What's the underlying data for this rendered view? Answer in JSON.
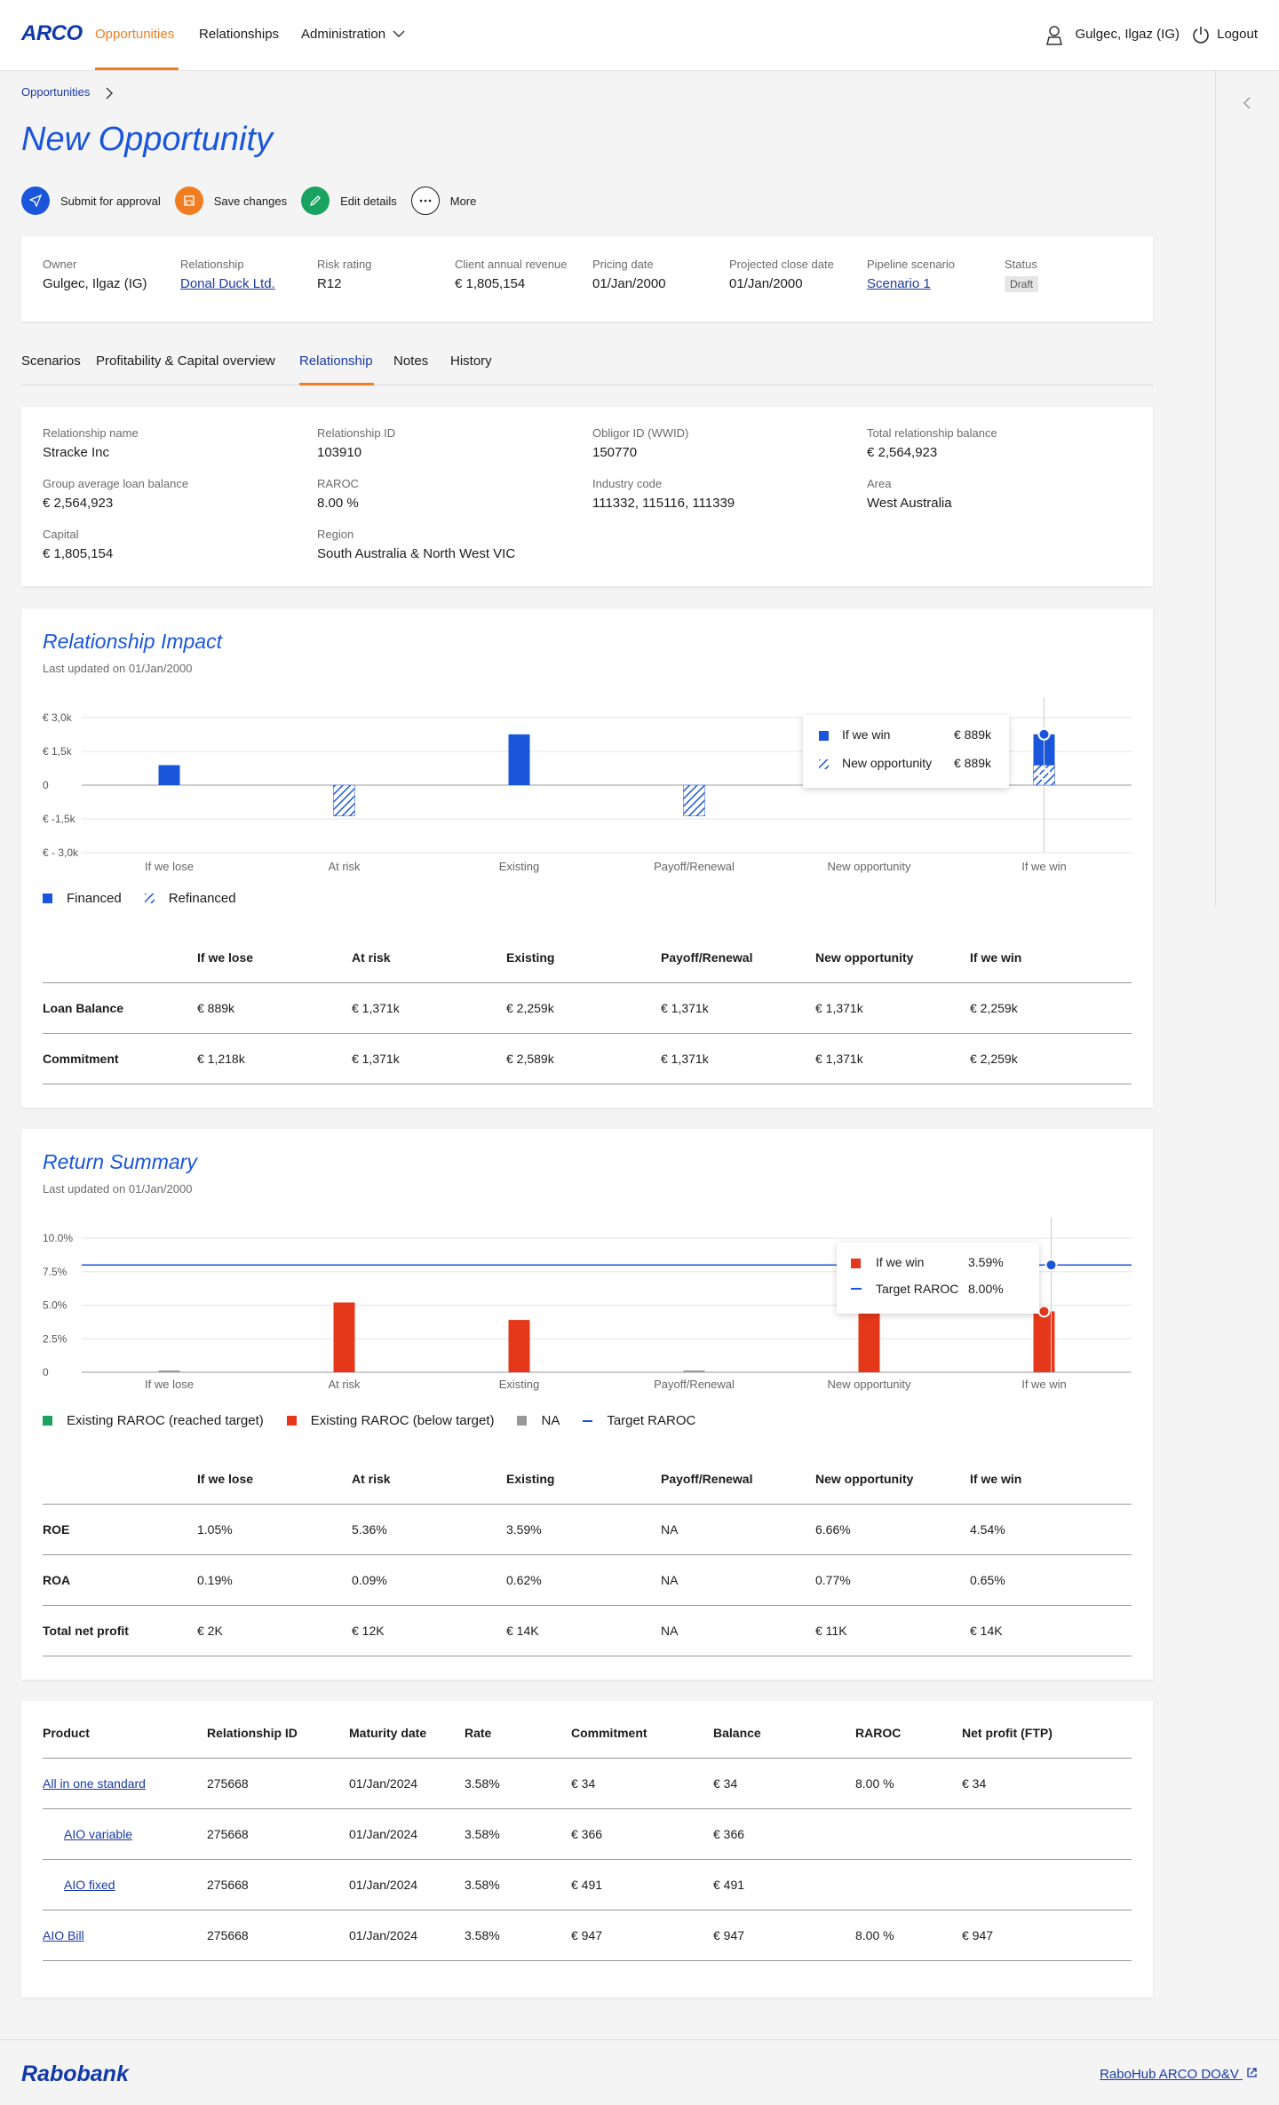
{
  "header": {
    "logo": "ARCO",
    "nav": [
      "Opportunities",
      "Relationships",
      "Administration"
    ],
    "user": "Gulgec, Ilgaz (IG)",
    "logout": "Logout"
  },
  "breadcrumb": "Opportunities",
  "page_title": "New Opportunity",
  "actions": [
    {
      "label": "Submit for approval",
      "icon": "send-icon",
      "color": "#1a56db"
    },
    {
      "label": "Save changes",
      "icon": "save-icon",
      "color": "#ef7d22"
    },
    {
      "label": "Edit details",
      "icon": "pencil-icon",
      "color": "#1aa260"
    },
    {
      "label": "More",
      "icon": "more-icon",
      "color": "#ffffff"
    }
  ],
  "summary": {
    "owner_label": "Owner",
    "owner": "Gulgec, Ilgaz (IG)",
    "relationship_label": "Relationship",
    "relationship": "Donal Duck Ltd.",
    "risk_label": "Risk rating",
    "risk": "R12",
    "revenue_label": "Client annual revenue",
    "revenue": "€ 1,805,154",
    "pricing_label": "Pricing date",
    "pricing": "01/Jan/2000",
    "close_label": "Projected close date",
    "close": "01/Jan/2000",
    "pipeline_label": "Pipeline scenario",
    "pipeline": "Scenario 1",
    "status_label": "Status",
    "status": "Draft"
  },
  "tabs": [
    "Scenarios",
    "Profitability & Capital overview",
    "Relationship",
    "Notes",
    "History"
  ],
  "relationship_info": {
    "name_label": "Relationship name",
    "name": "Stracke Inc",
    "id_label": "Relationship ID",
    "id": "103910",
    "obligor_label": "Obligor ID (WWID)",
    "obligor": "150770",
    "total_label": "Total relationship balance",
    "total": "€ 2,564,923",
    "gavg_label": "Group average loan balance",
    "gavg": "€ 2,564,923",
    "raroc_label": "RAROC",
    "raroc": "8.00 %",
    "industry_label": "Industry code",
    "industry": "111332, 115116, 111339",
    "area_label": "Area",
    "area": "West Australia",
    "capital_label": "Capital",
    "capital": "€ 1,805,154",
    "region_label": "Region",
    "region": "South Australia & North West VIC"
  },
  "impact": {
    "title": "Relationship Impact",
    "updated": "Last updated on 01/Jan/2000",
    "tooltip": {
      "win_label": "If we win",
      "win_value": "€ 889k",
      "new_label": "New opportunity",
      "new_value": "€ 889k"
    },
    "legend": {
      "financed": "Financed",
      "refinanced": "Refinanced"
    },
    "table": {
      "headers": [
        "",
        "If  we lose",
        "At risk",
        "Existing",
        "Payoff/Renewal",
        "New opportunity",
        "If we win"
      ],
      "rows": [
        [
          "Loan Balance",
          "€ 889k",
          "€ 1,371k",
          "€ 2,259k",
          "€ 1,371k",
          "€ 1,371k",
          "€ 2,259k"
        ],
        [
          "Commitment",
          "€ 1,218k",
          "€ 1,371k",
          "€ 2,589k",
          "€ 1,371k",
          "€ 1,371k",
          "€ 2,259k"
        ]
      ]
    }
  },
  "returns": {
    "title": "Return Summary",
    "updated": "Last updated on 01/Jan/2000",
    "tooltip": {
      "win_label": "If we win",
      "win_value": "3.59%",
      "target_label": "Target RAROC",
      "target_value": "8.00%"
    },
    "legend": [
      "Existing RAROC (reached target)",
      "Existing RAROC (below target)",
      "NA",
      "Target RAROC"
    ],
    "table": {
      "headers": [
        "",
        "If  we lose",
        "At risk",
        "Existing",
        "Payoff/Renewal",
        "New opportunity",
        "If we win"
      ],
      "rows": [
        [
          "ROE",
          "1.05%",
          "5.36%",
          "3.59%",
          "NA",
          "6.66%",
          "4.54%"
        ],
        [
          "ROA",
          "0.19%",
          "0.09%",
          "0.62%",
          "NA",
          "0.77%",
          "0.65%"
        ],
        [
          "Total net profit",
          "€ 2K",
          "€ 12K",
          "€ 14K",
          "NA",
          "€ 11K",
          "€ 14K"
        ]
      ]
    }
  },
  "products": {
    "headers": [
      "Product",
      "Relationship ID",
      "Maturity date",
      "Rate",
      "Commitment",
      "Balance",
      "RAROC",
      "Net profit (FTP)"
    ],
    "rows": [
      [
        "All in one standard",
        "275668",
        "01/Jan/2024",
        "3.58%",
        "€ 34",
        "€ 34",
        "8.00 %",
        "€ 34"
      ],
      [
        "AIO variable",
        "275668",
        "01/Jan/2024",
        "3.58%",
        "€ 366",
        "€ 366",
        "",
        ""
      ],
      [
        "AIO fixed",
        "275668",
        "01/Jan/2024",
        "3.58%",
        "€ 491",
        "€ 491",
        "",
        ""
      ],
      [
        "AIO Bill",
        "275668",
        "01/Jan/2024",
        "3.58%",
        "€ 947",
        "€ 947",
        "8.00 %",
        "€ 947"
      ]
    ]
  },
  "footer": {
    "logo": "Rabobank",
    "link": "RaboHub ARCO DO&V"
  },
  "chart_data": [
    {
      "type": "bar",
      "title": "Relationship Impact",
      "categories": [
        "If we lose",
        "At risk",
        "Existing",
        "Payoff/Renewal",
        "New opportunity",
        "If we win"
      ],
      "ylim": [
        -3000,
        3000
      ],
      "yticks": [
        "€ 3,0k",
        "€ 1,5k",
        "0",
        "€ -1,5k",
        "€ - 3,0k"
      ],
      "series": [
        {
          "name": "Financed",
          "values": [
            889,
            null,
            2259,
            null,
            null,
            2259
          ],
          "color": "#1a56db"
        },
        {
          "name": "Refinanced",
          "values": [
            null,
            -1371,
            null,
            -1371,
            null,
            889
          ],
          "color": "#1a56db",
          "pattern": "hatched"
        }
      ]
    },
    {
      "type": "bar",
      "title": "Return Summary",
      "categories": [
        "If we lose",
        "At risk",
        "Existing",
        "Payoff/Renewal",
        "New opportunity",
        "If we win"
      ],
      "ylim": [
        0,
        10
      ],
      "yticks": [
        "10.0%",
        "7.5%",
        "5.0%",
        "2.5%",
        "0"
      ],
      "series": [
        {
          "name": "Existing RAROC (below target)",
          "values": [
            0.1,
            5.2,
            3.9,
            0.1,
            6.66,
            4.54
          ],
          "color": "#e5381a"
        },
        {
          "name": "Target RAROC",
          "values": [
            8,
            8,
            8,
            8,
            8,
            8
          ],
          "color": "#1a56db"
        }
      ]
    }
  ]
}
